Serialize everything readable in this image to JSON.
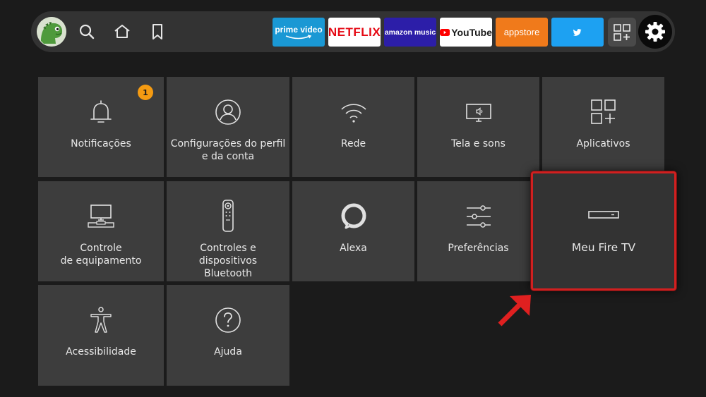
{
  "nav": {
    "icons": [
      "search-icon",
      "home-icon",
      "bookmark-icon"
    ],
    "apps": {
      "prime": "prime video",
      "netflix": "NETFLIX",
      "amazon_music": "amazon music",
      "youtube": "YouTube",
      "appstore": "appstore"
    }
  },
  "tiles": {
    "notificacoes": {
      "label": "Notificações",
      "badge": "1"
    },
    "perfil": {
      "label": "Configurações do perfil\ne da conta"
    },
    "rede": {
      "label": "Rede"
    },
    "tela": {
      "label": "Tela e sons"
    },
    "aplicativos": {
      "label": "Aplicativos"
    },
    "equipamento": {
      "label": "Controle\nde equipamento"
    },
    "bluetooth": {
      "label": "Controles e dispositivos\nBluetooth"
    },
    "alexa": {
      "label": "Alexa"
    },
    "preferencias": {
      "label": "Preferências"
    },
    "meufiretv": {
      "label": "Meu Fire TV"
    },
    "acessibilidade": {
      "label": "Acessibilidade"
    },
    "ajuda": {
      "label": "Ajuda"
    }
  },
  "colors": {
    "background": "#1b1b1b",
    "tile": "#3d3d3d",
    "focus_border": "#d02020",
    "badge": "#f59b12"
  }
}
